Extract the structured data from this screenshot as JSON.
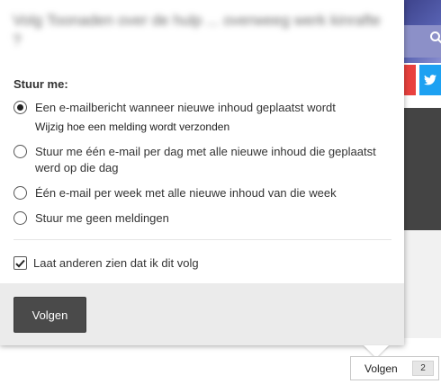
{
  "popup": {
    "title": "Volg Toonaden over de hulp ... overweeg werk kinrafte ?",
    "section_label": "Stuur me:",
    "options": [
      {
        "label": "Een e-mailbericht wanneer nieuwe inhoud geplaatst wordt",
        "sublabel": "Wijzig hoe een melding wordt verzonden",
        "checked": true
      },
      {
        "label": "Stuur me één e-mail per dag met alle nieuwe inhoud die geplaatst werd op die dag",
        "checked": false
      },
      {
        "label": "Één e-mail per week met alle nieuwe inhoud van die week",
        "checked": false
      },
      {
        "label": "Stuur me geen meldingen",
        "checked": false
      }
    ],
    "checkbox": {
      "label": "Laat anderen zien dat ik dit volg",
      "checked": true
    },
    "follow_button": "Volgen"
  },
  "follow_widget": {
    "label": "Volgen",
    "count": "2"
  },
  "background": {
    "twitter_icon": "twitter-icon",
    "search_icon": "search-icon",
    "colors": {
      "header": "#3a3f86",
      "red": "#e9413e",
      "twitter": "#1da1f2",
      "dark_panel": "#444444"
    }
  }
}
